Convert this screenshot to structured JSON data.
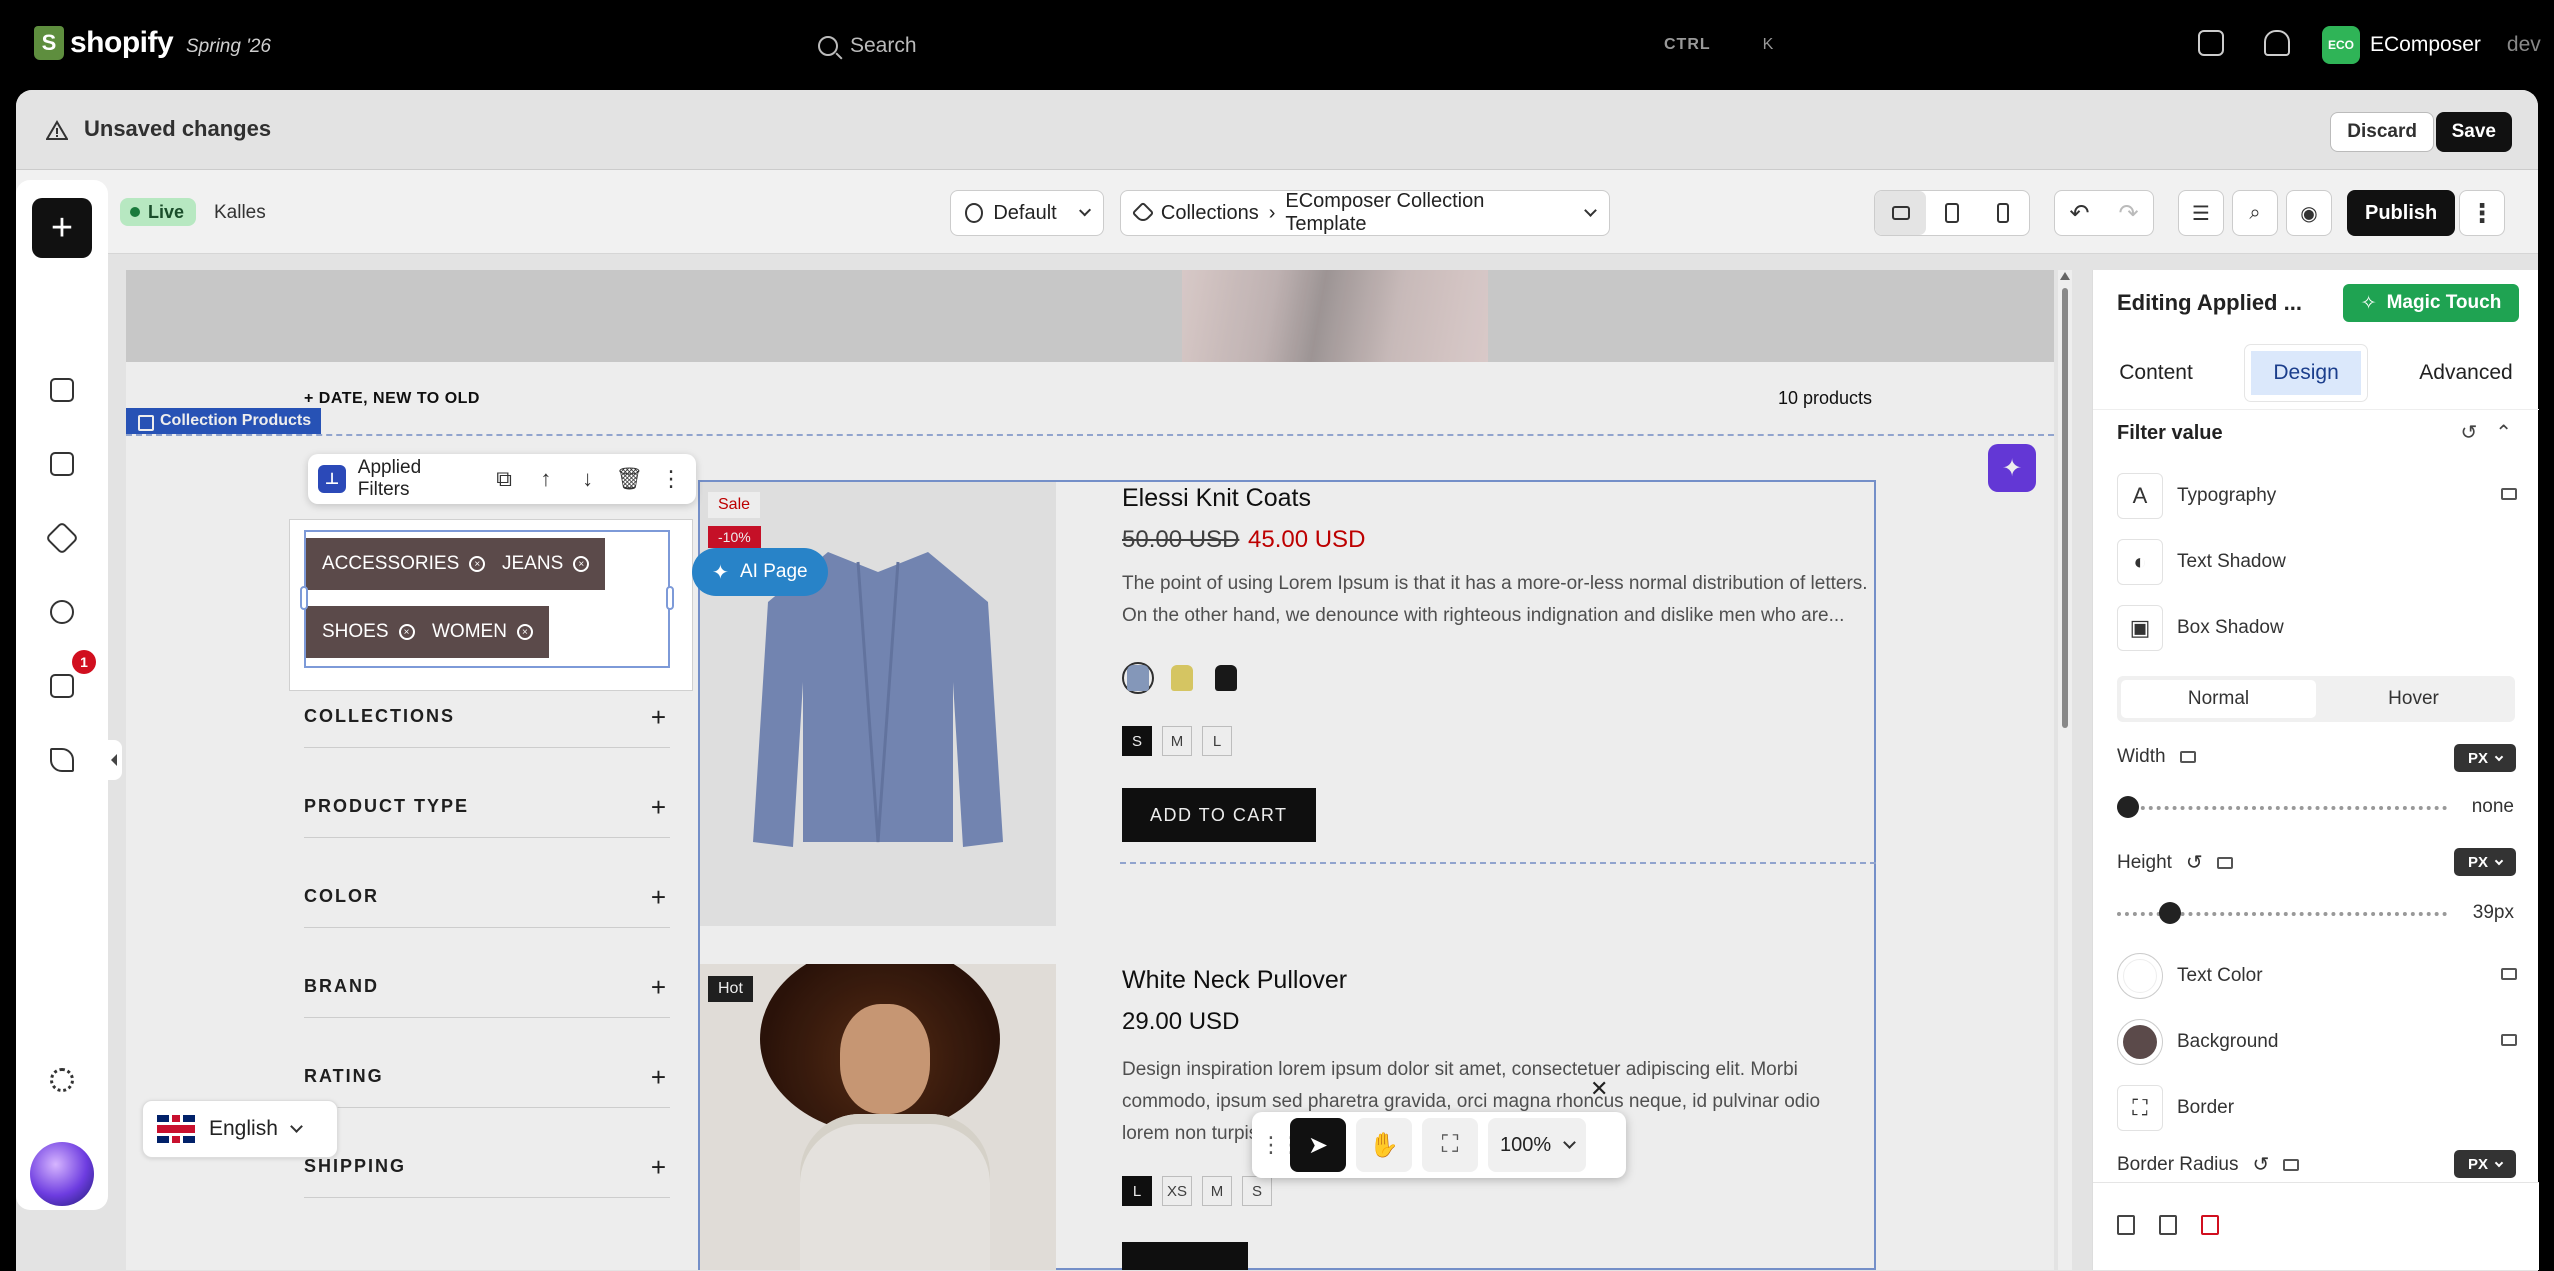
{
  "topbar": {
    "logo_text": "shopify",
    "edition": "Spring '26",
    "search_placeholder": "Search",
    "shortcut_ctrl": "CTRL",
    "shortcut_key": "K",
    "store_initials": "ECO",
    "store_name": "EComposer",
    "store_tag": "dev"
  },
  "notice": {
    "text": "Unsaved changes",
    "discard": "Discard",
    "save": "Save"
  },
  "toolbar": {
    "status": "Live",
    "theme": "Kalles",
    "locale": "Default",
    "breadcrumb_root": "Collections",
    "breadcrumb_sep": "›",
    "template": "EComposer Collection Template",
    "publish": "Publish"
  },
  "rail": {
    "badge_count": "1"
  },
  "canvas": {
    "sort_label": "+ DATE, NEW TO OLD",
    "product_count": "10 products",
    "section_label": "Collection Products",
    "element_toolbar_label": "Applied Filters",
    "ai_page_label": "AI Page",
    "applied_filters": [
      "ACCESSORIES",
      "JEANS",
      "SHOES",
      "WOMEN"
    ],
    "facets": [
      "COLLECTIONS",
      "PRODUCT TYPE",
      "COLOR",
      "BRAND",
      "RATING",
      "SHIPPING"
    ],
    "products": [
      {
        "title": "Elessi Knit Coats",
        "price_old": "50.00 USD",
        "price_new": "45.00 USD",
        "badge": "Sale",
        "discount": "-10%",
        "description": "The point of using Lorem Ipsum is that it has a more-or-less normal distribution of letters. On the other hand, we denounce with righteous indignation and dislike men who are...",
        "sizes": [
          "S",
          "M",
          "L"
        ],
        "cta": "ADD TO CART",
        "swatch_colors": [
          "#8fa3c8",
          "#e6d46a",
          "#1a1a1a"
        ]
      },
      {
        "title": "White Neck Pullover",
        "price": "29.00 USD",
        "badge": "Hot",
        "description": "Design inspiration lorem ipsum dolor sit amet, consectetuer adipiscing elit. Morbi commodo, ipsum sed pharetra gravida, orci magna rhoncus neque, id pulvinar odio lorem non turpis. Nullam sit amet",
        "sizes": [
          "L",
          "XS",
          "M",
          "S"
        ]
      }
    ],
    "zoom": "100%",
    "language": "English"
  },
  "panel": {
    "title": "Editing Applied ...",
    "magic_touch": "Magic Touch",
    "tabs": [
      "Content",
      "Design",
      "Advanced"
    ],
    "section": "Filter value",
    "typography": "Typography",
    "text_shadow": "Text Shadow",
    "box_shadow": "Box Shadow",
    "state_normal": "Normal",
    "state_hover": "Hover",
    "width_label": "Width",
    "width_unit": "PX",
    "width_value": "none",
    "height_label": "Height",
    "height_unit": "PX",
    "height_value": "39px",
    "text_color_label": "Text Color",
    "text_color": "#ffffff",
    "background_label": "Background",
    "background_color": "#5b4a4a",
    "border_label": "Border",
    "border_radius_label": "Border Radius",
    "border_radius_unit": "PX"
  },
  "colors": {
    "accent": "#2b59c3",
    "chip": "#5b4a4a",
    "sale": "#cc0000",
    "magic": "#1fa352"
  }
}
